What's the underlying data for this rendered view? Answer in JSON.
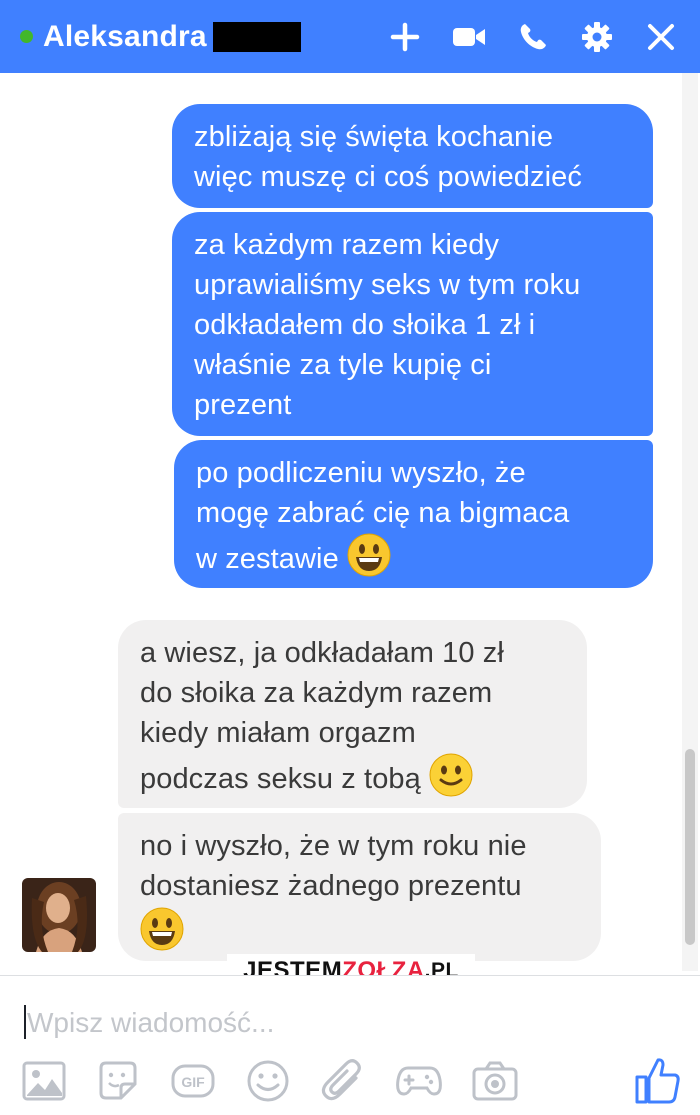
{
  "header": {
    "contact_name": "Aleksandra",
    "presence_status_color": "#42b72a",
    "background_color": "#4080ff",
    "icons": [
      "plus-icon",
      "video-camera-icon",
      "phone-icon",
      "gear-icon",
      "close-icon"
    ]
  },
  "messages": [
    {
      "side": "outgoing",
      "text": "zbliżają się święta kochanie\nwięc muszę ci coś powiedzieć"
    },
    {
      "side": "outgoing",
      "text": "za każdym razem kiedy\nuprawialiśmy seks w tym roku\nodkładałem do słoika 1 zł i\nwłaśnie za tyle kupię ci\nprezent"
    },
    {
      "side": "outgoing",
      "text": "po podliczeniu wyszło, że\nmogę zabrać cię na bigmaca\nw zestawie",
      "emoji": "grinning-face-emoji"
    },
    {
      "side": "incoming",
      "text": "a wiesz, ja odkładałam 10 zł\ndo słoika za każdym razem\nkiedy miałam orgazm\npodczas seksu z tobą",
      "emoji": "slightly-smiling-face-emoji"
    },
    {
      "side": "incoming",
      "text": "no i wyszło, że w tym roku nie\ndostaniesz żadnego prezentu",
      "emoji": "grinning-face-emoji"
    }
  ],
  "watermark": {
    "part1": "JESTEM",
    "part2": "ZOŁZA",
    "part3": ".PL"
  },
  "composer": {
    "placeholder": "Wpisz wiadomość...",
    "tools": [
      "image-icon",
      "sticker-icon",
      "gif-icon",
      "emoji-icon",
      "attachment-icon",
      "game-controller-icon",
      "camera-icon"
    ],
    "send_icon": "thumbs-up-icon"
  },
  "colors": {
    "accent": "#4080ff",
    "incoming_bubble": "#f1f0f0",
    "outgoing_bubble": "#4080ff"
  }
}
